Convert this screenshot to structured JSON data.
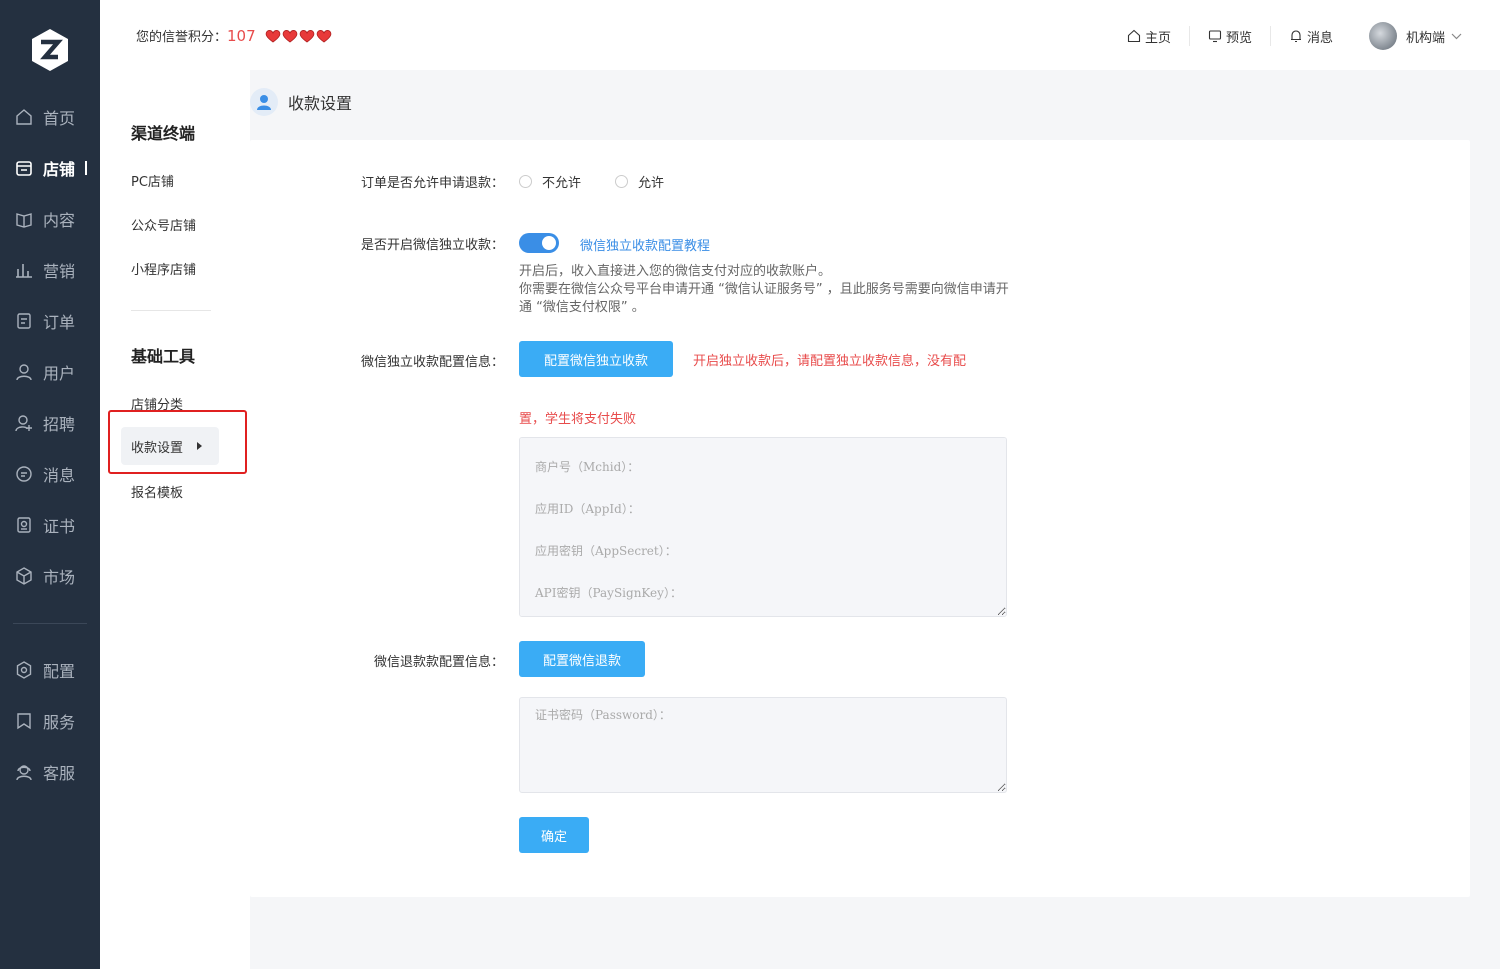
{
  "nav": {
    "items": [
      {
        "label": "首页",
        "icon": "home-icon"
      },
      {
        "label": "店铺",
        "icon": "store-icon",
        "active": true
      },
      {
        "label": "内容",
        "icon": "book-icon"
      },
      {
        "label": "营销",
        "icon": "chart-icon"
      },
      {
        "label": "订单",
        "icon": "order-icon"
      },
      {
        "label": "用户",
        "icon": "user-icon"
      },
      {
        "label": "招聘",
        "icon": "recruit-icon"
      },
      {
        "label": "消息",
        "icon": "message-icon"
      },
      {
        "label": "证书",
        "icon": "certificate-icon"
      },
      {
        "label": "市场",
        "icon": "market-icon"
      },
      {
        "label": "配置",
        "icon": "settings-icon"
      },
      {
        "label": "服务",
        "icon": "bookmark-icon"
      },
      {
        "label": "客服",
        "icon": "support-icon"
      }
    ]
  },
  "header": {
    "credit_label": "您的信誉积分：",
    "credit_score": "107",
    "hearts": 4,
    "links": [
      {
        "label": "主页",
        "icon": "home-icon"
      },
      {
        "label": "预览",
        "icon": "monitor-icon"
      },
      {
        "label": "消息",
        "icon": "bell-icon"
      }
    ],
    "user_name": "机构端"
  },
  "subnav": {
    "section1_title": "渠道终端",
    "section1_items": [
      "PC店铺",
      "公众号店铺",
      "小程序店铺"
    ],
    "section2_title": "基础工具",
    "section2_items": [
      "店铺分类",
      "收款设置",
      "报名模板"
    ]
  },
  "page": {
    "title": "收款设置"
  },
  "form": {
    "refund_label": "订单是否允许申请退款：",
    "refund_options": [
      "不允许",
      "允许"
    ],
    "wx_independent_label": "是否开启微信独立收款：",
    "wx_independent_on": true,
    "tutorial_link": "微信独立收款配置教程",
    "hint_line1": "开启后，收入直接进入您的微信支付对应的收款账户。",
    "hint_line2": "你需要在微信公众号平台申请开通 “微信认证服务号” ，且此服务号需要向微信申请开通 “微信支付权限” 。",
    "config_label": "微信独立收款配置信息：",
    "config_button": "配置微信独立收款",
    "config_warning_1": "开启独立收款后，请配置独立收款信息，没有配",
    "config_warning_2": "置，学生将支付失败",
    "config_placeholder": "商户号（Mchid）：\n应用ID（AppId）：\n应用密钥（AppSecret）：\nAPI密钥（PaySignKey）：",
    "refund_config_label": "微信退款款配置信息：",
    "refund_config_button": "配置微信退款",
    "password_placeholder": "证书密码（Password）：",
    "submit": "确定"
  },
  "colors": {
    "nav_bg": "#243040",
    "primary": "#3aacf5",
    "toggle": "#3a8ee6",
    "warning": "#e84c4c",
    "highlight_box": "#e02020"
  }
}
